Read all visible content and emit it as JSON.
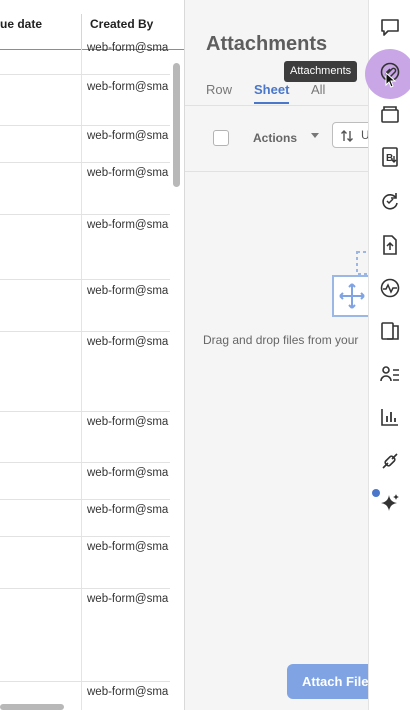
{
  "grid": {
    "columns": [
      "ue date",
      "Created By"
    ],
    "created_by_values": [
      "web-form@sma",
      "web-form@sma",
      "web-form@sma",
      "web-form@sma",
      "web-form@sma",
      "web-form@sma",
      "web-form@sma",
      "web-form@sma",
      "web-form@sma",
      "web-form@sma",
      "web-form@sma",
      "web-form@sma",
      "web-form@sma",
      "web-form@sma"
    ]
  },
  "panel": {
    "title": "Attachments",
    "tabs": [
      "Row",
      "Sheet",
      "All"
    ],
    "active_tab": "Sheet",
    "actions_label": "Actions",
    "sort_label": "U",
    "drop_text": "Drag and drop files from your",
    "attach_button": "Attach File"
  },
  "tooltip": "Attachments",
  "rail": {
    "icons": [
      "comment-icon",
      "attachments-icon",
      "proofs-icon",
      "summary-icon",
      "update-requests-icon",
      "publish-icon",
      "activity-icon",
      "forms-icon",
      "contacts-icon",
      "reports-icon",
      "connections-icon",
      "ai-sparkle-icon"
    ],
    "active": "attachments-icon",
    "accent": "#c9a7e6"
  },
  "colors": {
    "link": "#4a77c9",
    "button": "#7fa3e3"
  }
}
